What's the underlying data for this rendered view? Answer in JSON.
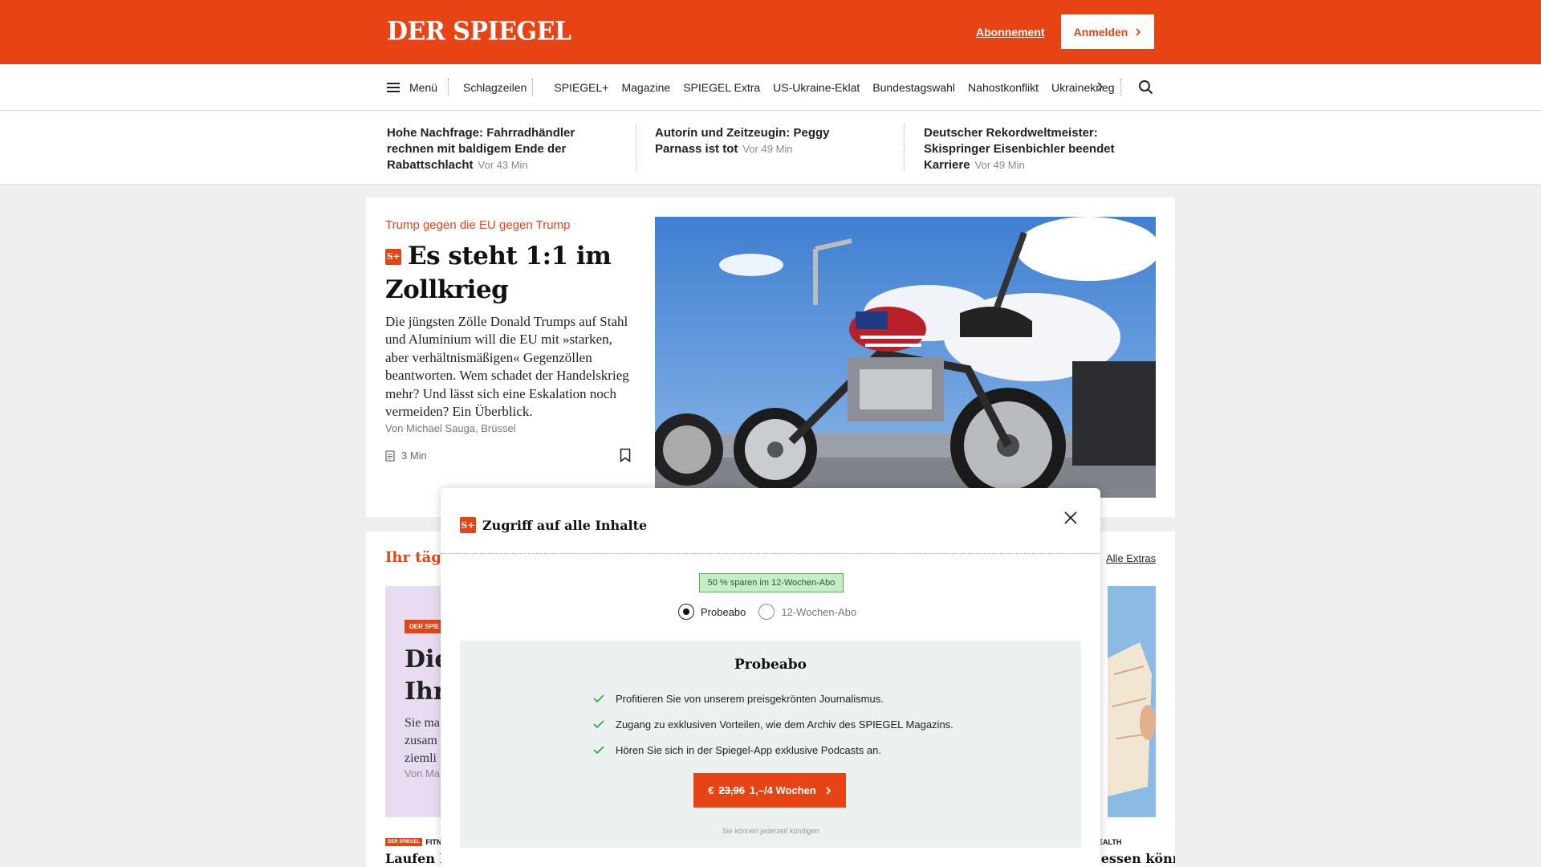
{
  "header": {
    "logo": "DER SPIEGEL",
    "subscription_link": "Abonnement",
    "login_button": "Anmelden",
    "brand_color": "#e64415"
  },
  "nav": {
    "menu_label": "Menü",
    "items": [
      "Schlagzeilen",
      "SPIEGEL+",
      "Magazine",
      "SPIEGEL Extra",
      "US-Ukraine-Eklat",
      "Bundestagswahl",
      "Nahostkonflikt",
      "Ukrainekrieg"
    ],
    "chevron_icon": "chevron-right-icon",
    "search_icon": "search-icon"
  },
  "ticker": [
    {
      "title": "Hohe Nachfrage: Fahrradhändler rechnen mit baldigem Ende der Rabattschlacht",
      "time": "Vor 43 Min"
    },
    {
      "title": "Autorin und Zeitzeugin: Peggy Parnass ist tot",
      "time": "Vor 49 Min"
    },
    {
      "title": "Deutscher Rekordweltmeister: Skispringer Eisenbichler beendet Karriere",
      "time": "Vor 49 Min"
    }
  ],
  "lead": {
    "kicker": "Trump gegen die EU gegen Trump",
    "splus_label": "S+",
    "headline": "Es steht 1:1 im Zollkrieg",
    "teaser": "Die jüngsten Zölle Donald Trumps auf Stahl und Aluminium will die EU mit »starken, aber verhältnismäßigen« Gegenzöllen beantworten. Wem schadet der Handelskrieg mehr? Und lässt sich eine Eskalation noch vermeiden? Ein Überblick.",
    "author": "Von Michael Sauga, Brüssel",
    "read_time": "3 Min"
  },
  "section2": {
    "title": "Ihr täglic",
    "all_extras": "Alle Extras",
    "promo_badge": "DER SPIE",
    "promo_title_line1": "Die",
    "promo_title_line2": "Ihr",
    "promo_text_line1": "Sie ma",
    "promo_text_line2": "zusam",
    "promo_text_line3": "ziemli",
    "promo_author": "Von Ma",
    "footer_left_badge": "DER SPIEGEL",
    "footer_left_label": "FITNE",
    "footer_left_title": "Laufen ka",
    "footer_right_label": "EALTH",
    "footer_right_title": "e essen könn"
  },
  "modal": {
    "splus_label": "S+",
    "title": "Zugriff auf alle Inhalte",
    "save_badge": "50 % sparen im 12-Wochen-Abo",
    "options": [
      {
        "label": "Probeabo",
        "selected": true
      },
      {
        "label": "12-Wochen-Abo",
        "selected": false
      }
    ],
    "plan_title": "Probeabo",
    "benefits": [
      "Profitieren Sie von unserem preisgekrönten Journalismus.",
      "Zugang zu exklusiven Vorteilen, wie dem Archiv des SPIEGEL Magazins.",
      "Hören Sie sich in der Spiegel-App exklusive Podcasts an."
    ],
    "cta_currency": "€",
    "cta_old_price": "23,96",
    "cta_price": "1,–/4 Wochen",
    "cancel_note": "Sie können jederzeit kündigen",
    "check_color": "#3aaa3a"
  }
}
